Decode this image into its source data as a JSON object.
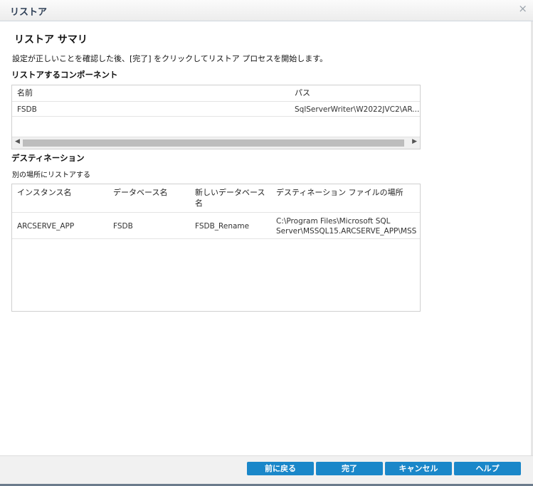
{
  "window": {
    "title": "リストア",
    "close_glyph": "×"
  },
  "heading": "リストア サマリ",
  "description": "設定が正しいことを確認した後、[完了] をクリックしてリストア プロセスを開始します。",
  "components": {
    "section_title": "リストアするコンポーネント",
    "columns": [
      "名前",
      "パス"
    ],
    "rows": [
      {
        "name": "FSDB",
        "path": "SqlServerWriter\\W2022JVC2\\AR..."
      }
    ]
  },
  "destination": {
    "section_title": "デスティネーション",
    "option": "別の場所にリストアする",
    "columns": [
      "インスタンス名",
      "データベース名",
      "新しいデータベース名",
      "デスティネーション ファイルの場所"
    ],
    "rows": [
      {
        "instance": "ARCSERVE_APP",
        "database": "FSDB",
        "new_database": "FSDB_Rename",
        "location_line1": "C:\\Program Files\\Microsoft SQL",
        "location_line2": "Server\\MSSQL15.ARCSERVE_APP\\MSS"
      }
    ]
  },
  "buttons": {
    "back": "前に戻る",
    "finish": "完了",
    "cancel": "キャンセル",
    "help": "ヘルプ"
  }
}
